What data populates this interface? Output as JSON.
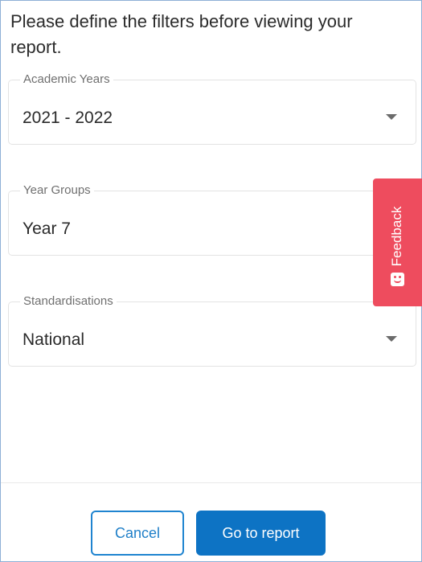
{
  "intro": {
    "text": "Please define the filters before viewing your report."
  },
  "filters": [
    {
      "label": "Academic Years",
      "value": "2021 - 2022",
      "has_dropdown": true
    },
    {
      "label": "Year Groups",
      "value": "Year 7",
      "has_dropdown": false
    },
    {
      "label": "Standardisations",
      "value": "National",
      "has_dropdown": true
    }
  ],
  "feedback": {
    "label": "Feedback",
    "icon": "smiley-face-icon",
    "color": "#ee4c5e"
  },
  "actions": {
    "cancel_label": "Cancel",
    "go_label": "Go to report",
    "primary_color": "#0d73c4"
  }
}
